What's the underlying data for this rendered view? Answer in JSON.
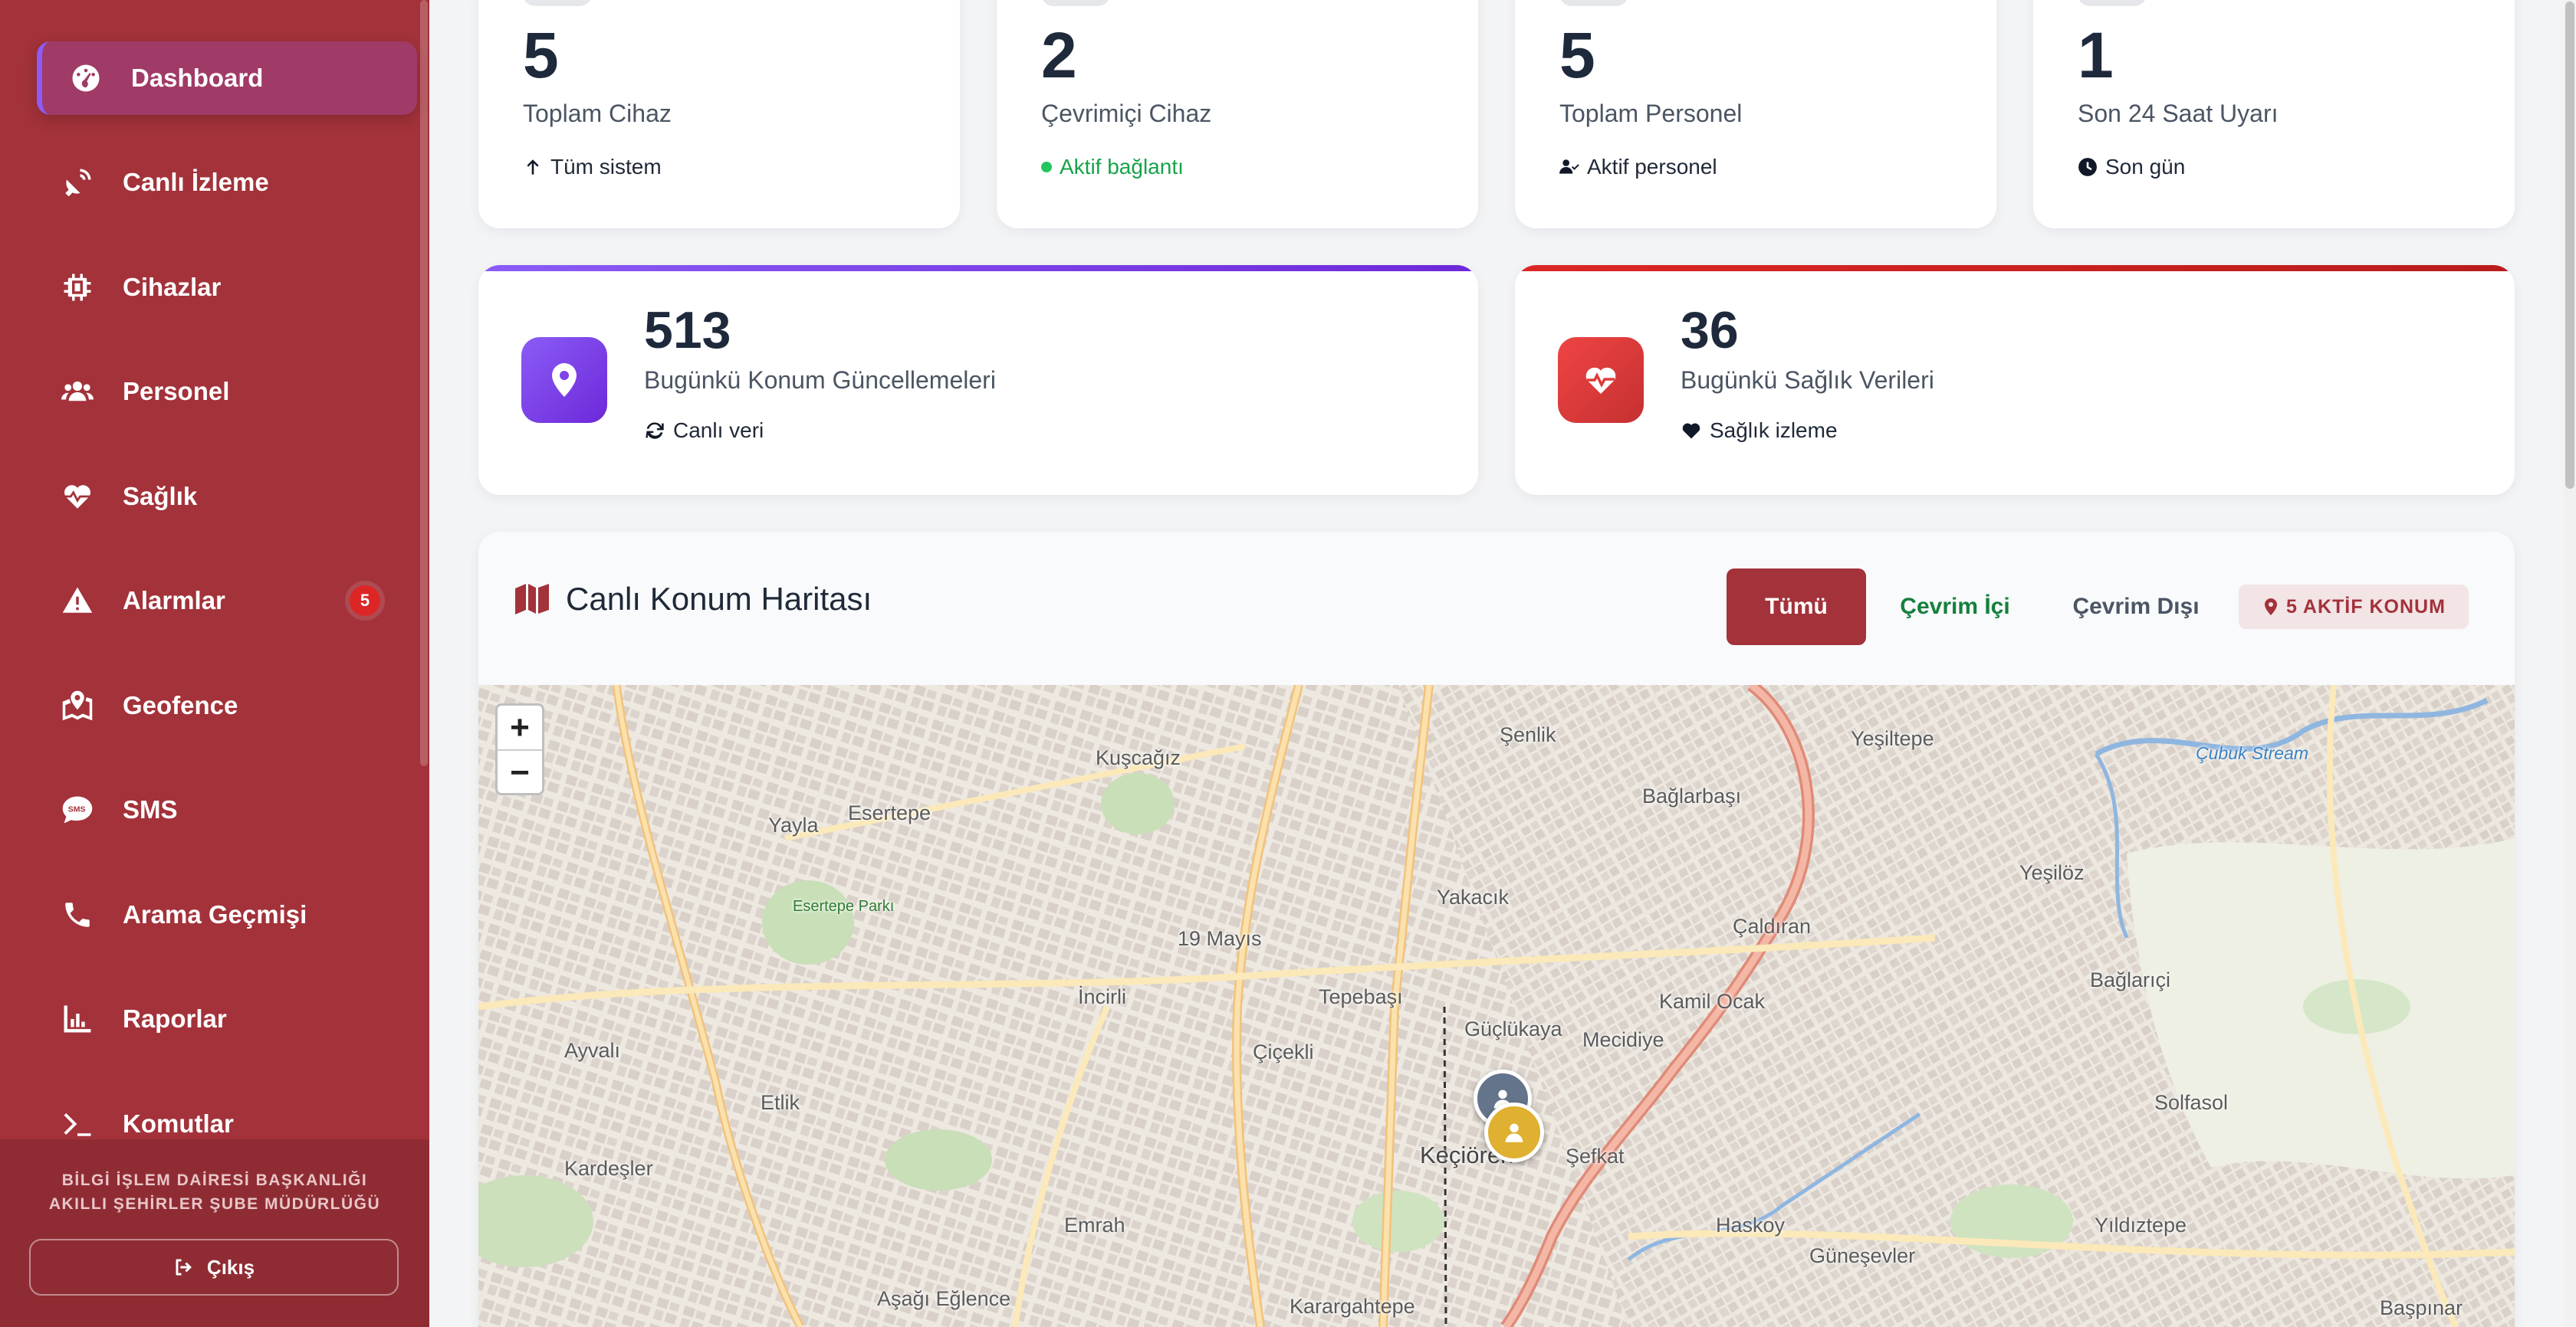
{
  "sidebar": {
    "items": [
      {
        "label": "Dashboard",
        "icon": "dashboard-gauge-icon",
        "active": true
      },
      {
        "label": "Canlı İzleme",
        "icon": "satellite-dish-icon"
      },
      {
        "label": "Cihazlar",
        "icon": "microchip-icon"
      },
      {
        "label": "Personel",
        "icon": "users-icon"
      },
      {
        "label": "Sağlık",
        "icon": "heart-pulse-icon"
      },
      {
        "label": "Alarmlar",
        "icon": "warning-triangle-icon",
        "badge": "5"
      },
      {
        "label": "Geofence",
        "icon": "map-marked-icon"
      },
      {
        "label": "SMS",
        "icon": "sms-bubble-icon"
      },
      {
        "label": "Arama Geçmişi",
        "icon": "phone-icon"
      },
      {
        "label": "Raporlar",
        "icon": "chart-line-icon"
      },
      {
        "label": "Komutlar",
        "icon": "terminal-icon"
      }
    ],
    "org_line1": "BİLGİ İŞLEM DAİRESİ BAŞKANLIĞI",
    "org_line2": "AKILLI ŞEHİRLER ŞUBE MÜDÜRLÜĞÜ",
    "logout_label": "Çıkış"
  },
  "stats": [
    {
      "value": "5",
      "label": "Toplam Cihaz",
      "sub": "Tüm sistem",
      "icon": "arrow-up-icon"
    },
    {
      "value": "2",
      "label": "Çevrimiçi Cihaz",
      "sub": "Aktif bağlantı",
      "icon": "status-dot-icon"
    },
    {
      "value": "5",
      "label": "Toplam Personel",
      "sub": "Aktif personel",
      "icon": "user-check-icon"
    },
    {
      "value": "1",
      "label": "Son 24 Saat Uyarı",
      "sub": "Son gün",
      "icon": "clock-icon"
    }
  ],
  "wide_stats": [
    {
      "value": "513",
      "label": "Bugünkü Konum Güncellemeleri",
      "sub": "Canlı veri",
      "icon": "location-pin-icon",
      "accent": "#7c3aed"
    },
    {
      "value": "36",
      "label": "Bugünkü Sağlık Verileri",
      "sub": "Sağlık izleme",
      "icon": "heartbeat-icon",
      "accent": "#dc2626"
    }
  ],
  "map_panel": {
    "title": "Canlı Konum Haritası",
    "filters": [
      "Tümü",
      "Çevrim İçi",
      "Çevrim Dışı"
    ],
    "active_filter": "Tümü",
    "active_badge": "5 AKTİF KONUM",
    "zoom_in": "+",
    "zoom_out": "−"
  },
  "map_labels": [
    "Şenlik",
    "Yeşiltepe",
    "Kuşcağız",
    "Esertepe",
    "Bağlarbaşı",
    "Yayla",
    "Yeşilöz",
    "Yakacık",
    "Çaldıran",
    "19 Mayıs",
    "Bağlarıçi",
    "İncirli",
    "Tepebaşı",
    "Güçlükaya",
    "Kamil Ocak",
    "Ayvalı",
    "Mecidiye",
    "Çiçekli",
    "Etlik",
    "Solfasol",
    "Keçiören",
    "Şefkat",
    "Kardeşler",
    "Haskoy",
    "Yıldıztepe",
    "Emrah",
    "Güneşevler",
    "Aşağı Eğlence",
    "Karargahtepe",
    "Başpınar",
    "Çubuk Stream",
    "Esertepe Parkı"
  ],
  "colors": {
    "sidebar": "#a3323a",
    "sidebar_active": "#a03a66",
    "accent_purple": "#7c3aed",
    "accent_red": "#dc2626",
    "online_green": "#16a34a"
  }
}
